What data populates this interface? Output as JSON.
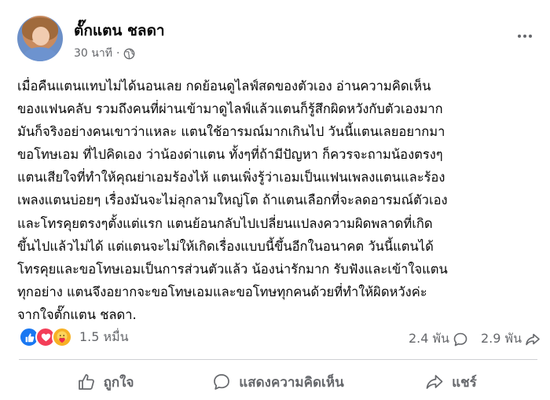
{
  "author": {
    "name": "ตั๊กแตน ชลดา",
    "time": "30 นาที",
    "separator": "·"
  },
  "icons": {
    "avatar": "profile-photo",
    "privacy": "globe-icon",
    "more": "more-options-icon",
    "reaction_like": "like-reaction-icon",
    "reaction_love": "love-reaction-icon",
    "reaction_care": "care-reaction-icon",
    "comment": "comment-icon",
    "share": "share-icon",
    "like": "thumbs-up-icon"
  },
  "post": {
    "lines": [
      "เมื่อคืนแตนแทบไม่ได้นอนเลย กดย้อนดูไลฟ์สดของตัวเอง อ่านความคิดเห็น",
      "ของแฟนคลับ รวมถึงคนที่ผ่านเข้ามาดูไลฟ์แล้วแตนก็รู้สึกผิดหวังกับตัวเองมาก",
      "มันก็จริงอย่างคนเขาว่าแหละ แตนใช้อารมณ์มากเกินไป วันนี้แตนเลยอยากมา",
      "ขอโทษเอม ที่ไปคิดเอง ว่าน้องด่าแตน ทั้งๆที่ถ้ามีปัญหา ก็ควรจะถามน้องตรงๆ",
      "แตนเสียใจที่ทำให้คุณย่าเอมร้องไห้ แตนเพิ่งรู้ว่าเอมเป็นแฟนเพลงแตนและร้อง",
      "เพลงแตนบ่อยๆ เรื่องมันจะไม่ลุกลามใหญ่โต ถ้าแตนเลือกที่จะลดอารมณ์ตัวเอง",
      "และโทรคุยตรงๆตั้งแต่แรก แตนย้อนกลับไปเปลี่ยนแปลงความผิดพลาดที่เกิด",
      "ขึ้นไปแล้วไม่ได้ แต่แตนจะไม่ให้เกิดเรื่องแบบนี้ขึ้นอีกในอนาคต วันนี้แตนได้",
      "โทรคุยและขอโทษเอมเป็นการส่วนตัวแล้ว น้องน่ารักมาก รับฟังและเข้าใจแตน",
      "ทุกอย่าง แตนจึงอยากจะขอโทษเอมและขอโทษทุกคนด้วยที่ทำให้ผิดหวังค่ะ",
      "จากใจตั๊กแตน ชลดา."
    ]
  },
  "stats": {
    "reactions": "1.5 หมื่น",
    "comments": "2.4 พัน",
    "shares": "2.9 พัน"
  },
  "actions": {
    "like": "ถูกใจ",
    "comment": "แสดงความคิดเห็น",
    "share": "แชร์"
  },
  "colors": {
    "like_blue": "#1877f2",
    "love_red": "#f33e58",
    "care_yellow": "#f7b125",
    "secondary_text": "#65676b"
  }
}
